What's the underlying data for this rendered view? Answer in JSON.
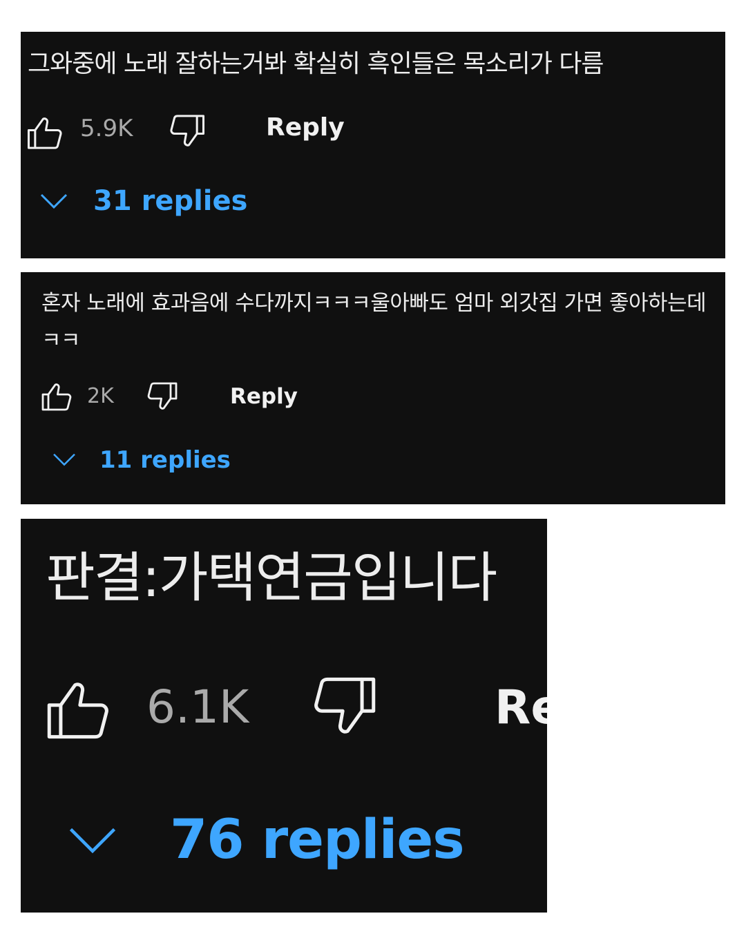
{
  "comments": [
    {
      "text": "그와중에 노래 잘하는거봐 확실히 흑인들은 목소리가 다름",
      "like_count": "5.9K",
      "reply_label": "Reply",
      "replies_label": "31 replies"
    },
    {
      "text": "혼자 노래에 효과음에 수다까지ㅋㅋㅋ울아빠도 엄마 외갓집 가면 좋아하는데ㅋㅋ",
      "like_count": "2K",
      "reply_label": "Reply",
      "replies_label": "11 replies"
    },
    {
      "text": "판결:가택연금입니다",
      "like_count": "6.1K",
      "reply_label": "Re",
      "replies_label": "76 replies"
    }
  ],
  "icons": {
    "like": "thumbs-up-icon",
    "dislike": "thumbs-down-icon",
    "expand": "chevron-down-icon"
  },
  "colors": {
    "panel_background": "#101010",
    "comment_text": "#ededed",
    "count_text": "#aaaaaa",
    "reply_text": "#f1f1f1",
    "replies_link": "#3ea6ff"
  }
}
